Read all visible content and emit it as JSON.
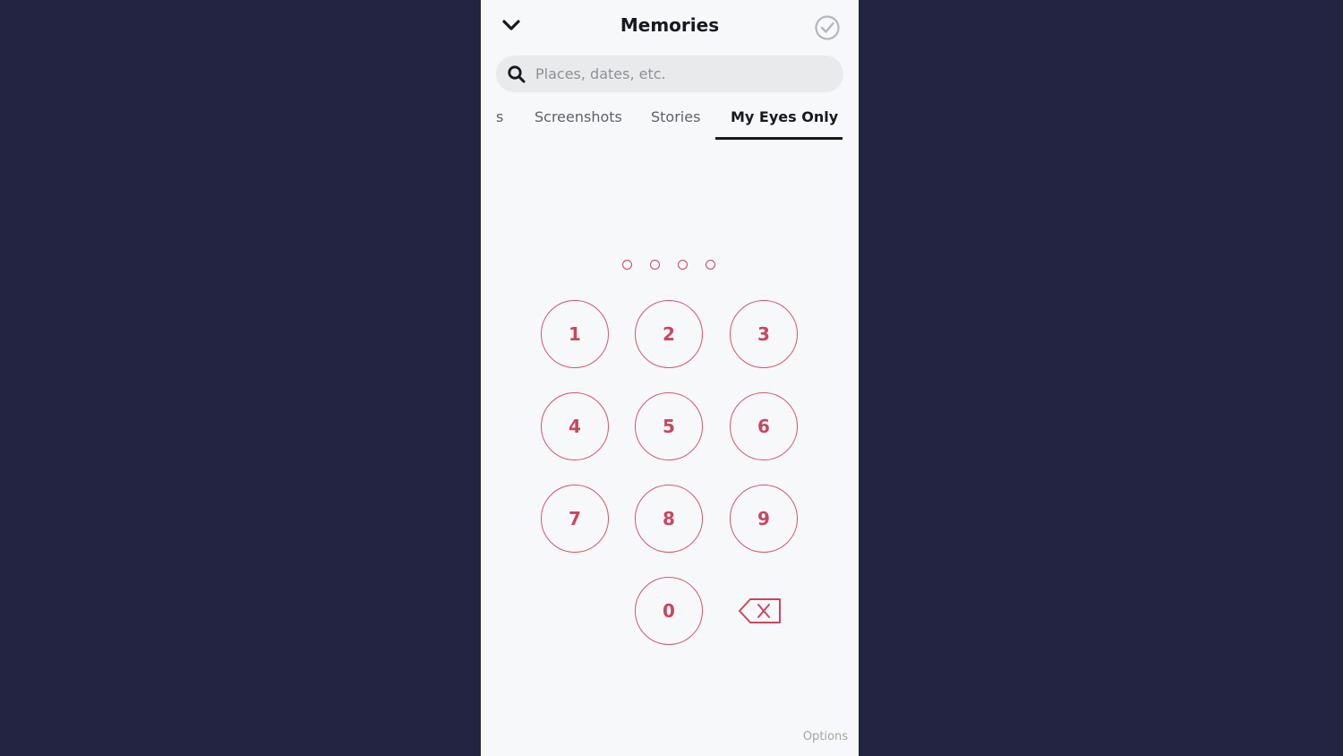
{
  "header": {
    "title": "Memories"
  },
  "search": {
    "placeholder": "Places, dates, etc.",
    "value": ""
  },
  "tabs": [
    {
      "label": "s",
      "active": false
    },
    {
      "label": "Screenshots",
      "active": false
    },
    {
      "label": "Stories",
      "active": false
    },
    {
      "label": "My Eyes Only",
      "active": true
    }
  ],
  "passcode": {
    "length": 4,
    "entered": 0
  },
  "keypad": {
    "keys": [
      "1",
      "2",
      "3",
      "4",
      "5",
      "6",
      "7",
      "8",
      "9",
      "0"
    ]
  },
  "footer": {
    "options_label": "Options"
  },
  "colors": {
    "background": "#232441",
    "panel": "#f7f8fa",
    "accent": "#c8475f",
    "text": "#16191f",
    "muted": "#8e9096"
  },
  "icons": {
    "chevron": "chevron-down-icon",
    "check": "check-circle-icon",
    "search": "search-icon",
    "backspace": "backspace-icon"
  }
}
